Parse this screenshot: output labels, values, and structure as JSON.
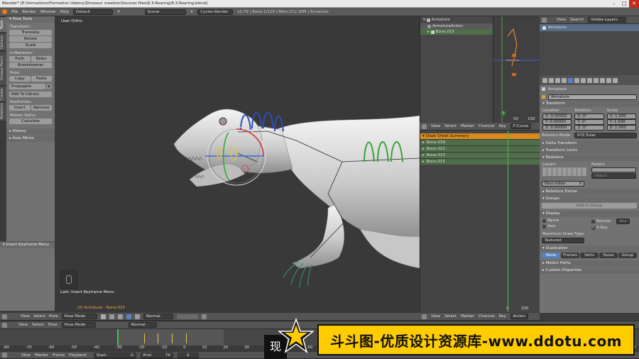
{
  "window": {
    "title": "Blender* [E:\\formations\\Formation Udemy\\Dinosour creation\\Sources files\\8.3-Roaring\\8.3-Roaring.blend]"
  },
  "menubar": {
    "items": [
      "File",
      "Render",
      "Window",
      "Help"
    ],
    "layout": "Default",
    "scene": "Scene",
    "engine": "Cycles Render",
    "stats": "v2.79 | Bone:1/129 | Mem:212.30M | Armature"
  },
  "toolshelf": {
    "tabs": [
      "Tools",
      "Options",
      "Grease Pencil",
      "Create",
      "Relations"
    ],
    "title": "Pose Tools",
    "transform_label": "Transform:",
    "translate": "Translate",
    "rotate": "Rotate",
    "scale": "Scale",
    "inbetween_label": "In-Between:",
    "push": "Push",
    "relax": "Relax",
    "breakdowner": "Breakdowner",
    "pose_label": "Pose:",
    "copy": "Copy",
    "paste": "Paste",
    "propagate": "Propagate",
    "add_library": "Add To Library",
    "keyframes_label": "Keyframes:",
    "insert": "Insert",
    "remove": "Remove",
    "motion_paths_label": "Motion Paths:",
    "calculate": "Calculate",
    "history": "History",
    "auto_mirror": "Auto Mirror",
    "operator_title": "Insert Keyframe Menu"
  },
  "viewport": {
    "view_label": "User Ortho",
    "last_op": "Last: Insert Keyframe Menu",
    "status": "(0) Armature : Bone.015",
    "header": {
      "view": "View",
      "select": "Select",
      "pose": "Pose",
      "mode": "Pose Mode",
      "pivot": "Normal"
    }
  },
  "outliner": {
    "items": [
      "Armature",
      "ArmatureAction",
      "Bone.015"
    ]
  },
  "graph_editor": {
    "labels": [
      "0",
      "50",
      "100"
    ]
  },
  "dopesheet": {
    "header": [
      "View",
      "Select",
      "Marker",
      "Channel",
      "Key",
      "F-Curve"
    ],
    "summary": "Dope Sheet Summary",
    "channels": [
      "Bone.039",
      "Bone.012",
      "Bone.013",
      "Bone.015"
    ],
    "frame_left": "0",
    "frame_right": "200",
    "bottom_header": [
      "View",
      "Select",
      "Marker",
      "Channel",
      "Key",
      "Action"
    ]
  },
  "properties": {
    "top_header": {
      "view": "View",
      "search": "Search",
      "visible_layers": "Visible Layers"
    },
    "outliner_item": "Armature",
    "object_breadcrumb": "Armature",
    "object_name": "Armature",
    "transform_title": "Transform",
    "location_label": "Location:",
    "rotation_label": "Rotation:",
    "scale_label": "Scale:",
    "location": [
      "X: 0.00000",
      "Y: 0.00000",
      "Z: 0.00000"
    ],
    "rotation": [
      "X: 0°",
      "Y: 0°",
      "Z: 0°"
    ],
    "scale": [
      "X: 1.000",
      "Y: 1.000",
      "Z: 1.000"
    ],
    "rotation_mode_label": "Rotation Mode:",
    "rotation_mode": "XYZ Euler",
    "delta_transform": "Delta Transform",
    "transform_locks": "Transform Locks",
    "relations": "Relations",
    "layers_label": "Layers:",
    "parent_label": "Parent:",
    "parent_type": "Object",
    "pass_index": "Pass Index:",
    "pass_value": "0",
    "relations_extras": "Relations Extras",
    "groups": "Groups",
    "add_to_group": "Add to Group",
    "display": "Display",
    "name": "Name",
    "axis": "Axis",
    "bounds": "Bounds",
    "box": "Box",
    "xray": "X-Ray",
    "max_draw_type_label": "Maximum Draw Type:",
    "max_draw_type": "Textured",
    "duplication": "Duplication",
    "dup_options": [
      "None",
      "Frames",
      "Verts",
      "Faces",
      "Group"
    ],
    "motion_paths": "Motion Paths",
    "custom_properties": "Custom Properties"
  },
  "timeline": {
    "header": {
      "view": "View",
      "select": "Select",
      "pose": "Pose",
      "mode": "Pose Mode",
      "pivot": "Normal"
    },
    "ticks": [
      "-80",
      "-70",
      "-60",
      "-50",
      "-40",
      "-30",
      "-20",
      "-10",
      "0",
      "10",
      "20",
      "30",
      "40",
      "50",
      "60",
      "70",
      "80",
      "90",
      "100",
      "110",
      "120",
      "130",
      "140",
      "150",
      "160",
      "170",
      "180",
      "190",
      "200"
    ],
    "footer": {
      "view": "View",
      "marker": "Marker",
      "frame": "Frame",
      "playback": "Playback",
      "start": "Start:",
      "start_val": "0",
      "end": "End:",
      "end_val": "79",
      "current": "0"
    }
  },
  "watermark": {
    "text": "斗斗图-优质设计资源库-www.ddotu.com",
    "left_text": "现"
  },
  "colors": {
    "accent": "#f07a1a",
    "selected": "#5680c2",
    "green_channel": "#4e6d48",
    "watermark_bg": "#ffcc00"
  }
}
